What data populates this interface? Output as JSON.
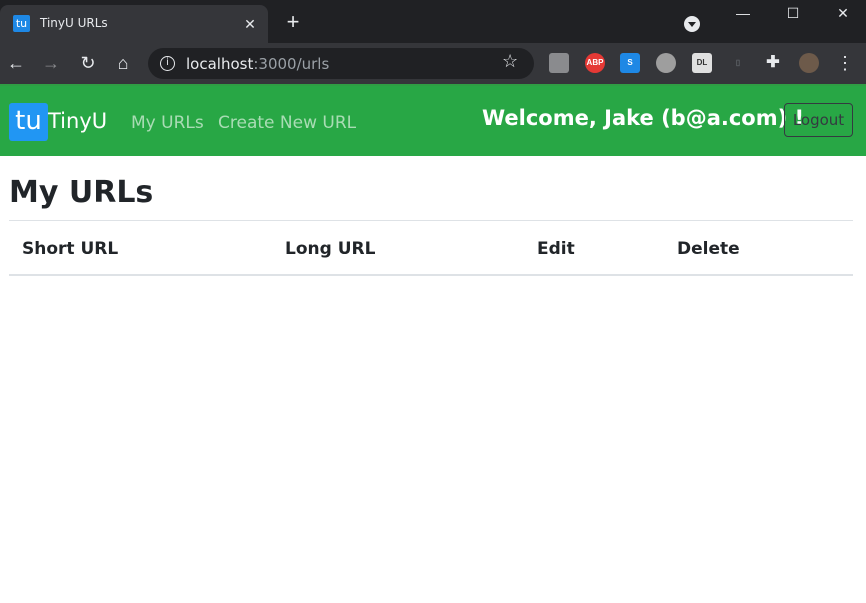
{
  "browser": {
    "tab_favicon": "tu",
    "tab_title": "TinyU URLs",
    "tab_close": "✕",
    "new_tab": "+",
    "url_host": "localhost",
    "url_path": ":3000/urls",
    "window_buttons": {
      "minimize": "—",
      "maximize": "☐",
      "close": "✕"
    }
  },
  "navbar": {
    "brand_logo": "tu",
    "brand_name": "TinyU",
    "links": [
      "My URLs",
      "Create New URL"
    ],
    "welcome": "Welcome, Jake (b@a.com) !",
    "logout_label": "Logout",
    "color": "#28a745"
  },
  "main": {
    "title": "My URLs",
    "table": {
      "headers": [
        "Short URL",
        "Long URL",
        "Edit",
        "Delete"
      ],
      "rows": []
    }
  }
}
